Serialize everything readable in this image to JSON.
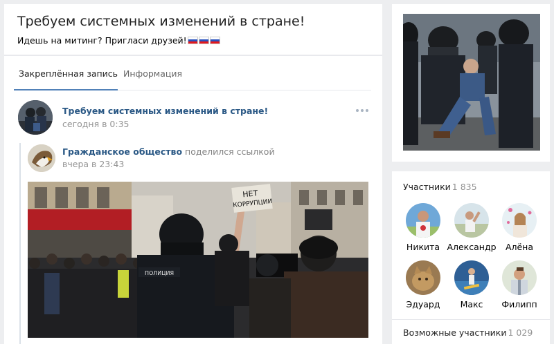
{
  "group": {
    "title": "Требуем системных изменений в стране!",
    "status": "Идешь на митинг? Пригласи друзей!"
  },
  "tabs": [
    {
      "label": "Закреплённая запись",
      "active": true
    },
    {
      "label": "Информация",
      "active": false
    }
  ],
  "post": {
    "author": "Требуем системных изменений в стране!",
    "time": "сегодня в 0:35",
    "repost": {
      "author": "Гражданское общество",
      "action": "поделился ссылкой",
      "time": "вчера в 23:43"
    },
    "photo": {
      "sign_line1": "НЕТ",
      "sign_line2": "КОРРУПЦИИ",
      "vest_text": "ПОЛИЦИЯ"
    }
  },
  "members": {
    "title": "Участники",
    "count": "1 835",
    "list": [
      {
        "name": "Никита"
      },
      {
        "name": "Александр"
      },
      {
        "name": "Алёна"
      },
      {
        "name": "Эдуард"
      },
      {
        "name": "Макс"
      },
      {
        "name": "Филипп"
      }
    ]
  },
  "possible_members": {
    "title": "Возможные участники",
    "count": "1 029"
  },
  "colors": {
    "link": "#2a5885",
    "accent": "#5181b8",
    "background": "#edeef0",
    "muted": "#939393"
  }
}
